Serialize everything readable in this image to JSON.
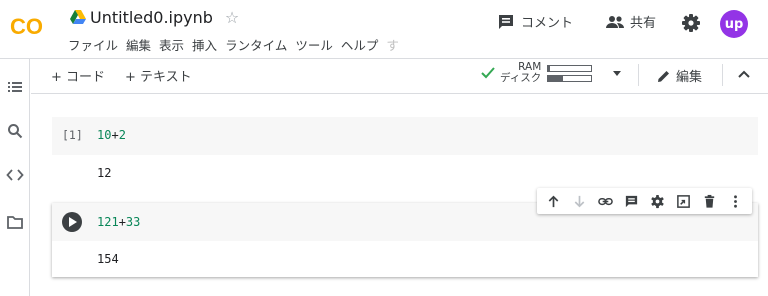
{
  "header": {
    "logo_text": "CO",
    "title": "Untitled0.ipynb",
    "star_glyph": "☆",
    "menu": [
      "ファイル",
      "編集",
      "表示",
      "挿入",
      "ランタイム",
      "ツール",
      "ヘルプ"
    ],
    "menu_trailing": "す",
    "comment_label": "コメント",
    "share_label": "共有",
    "avatar_initials": "up"
  },
  "toolbar": {
    "add_code_label": "+ コード",
    "add_text_label": "+ テキスト",
    "ram_label": "RAM",
    "disk_label": "ディスク",
    "ram_usage": 0.05,
    "disk_usage": 0.35,
    "edit_label": "編集"
  },
  "cells": [
    {
      "exec_count": "[1]",
      "code_parts": [
        {
          "text": "10",
          "kind": "num"
        },
        {
          "text": "+",
          "kind": "op"
        },
        {
          "text": "2",
          "kind": "num"
        }
      ],
      "output": "12"
    },
    {
      "code_parts": [
        {
          "text": "121",
          "kind": "num"
        },
        {
          "text": "+",
          "kind": "op"
        },
        {
          "text": "33",
          "kind": "num"
        }
      ],
      "output": "154"
    }
  ],
  "cell_toolbar_icons": [
    "arrow-up-icon",
    "arrow-down-icon",
    "link-icon",
    "comment-icon",
    "gear-icon",
    "mirror-cell-icon",
    "delete-icon",
    "more-icon"
  ],
  "colors": {
    "logo_orange": "#f9ab00",
    "avatar": "#9334e6",
    "check_green": "#34a853",
    "code_number": "#098658"
  }
}
